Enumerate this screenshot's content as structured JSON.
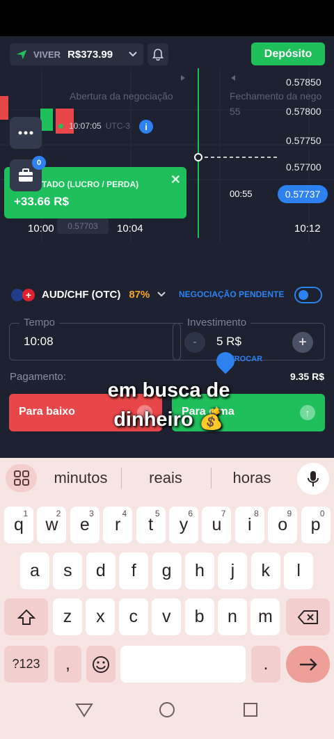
{
  "header": {
    "mode_label": "VIVER",
    "balance": "R$373.99",
    "deposit_label": "Depósito"
  },
  "chart": {
    "price_labels": [
      "0.57850",
      "0.57800",
      "0.57750",
      "0.57700"
    ],
    "current_price": "0.57737",
    "countdown": "00:55",
    "time_labels": [
      "10:00",
      "10:04",
      "10:12"
    ],
    "open_time": "10:07:05",
    "utc_label": "UTC-3",
    "open_label": "Abertura da negociação",
    "close_label": "Fechamento da nego",
    "close_counter": "55",
    "open_price": "0.57703",
    "info_label": "i"
  },
  "result_panel": {
    "label": "TADO (LUCRO / PERDA)",
    "value": "+33.66 R$",
    "badge": "0"
  },
  "pair": {
    "name": "AUD/CHF (OTC)",
    "payout_pct": "87%",
    "pending_label": "NEGOCIAÇÃO PENDENTE"
  },
  "inputs": {
    "time_legend": "Tempo",
    "time_value": "10:08",
    "investment_legend": "Investimento",
    "investment_value": "5 R$",
    "minus": "-",
    "plus": "+",
    "swap_label": "TROCAR"
  },
  "payment": {
    "label": "Pagamento:",
    "value": "9.35 R$"
  },
  "actions": {
    "down_label": "Para baixo",
    "up_label": "Para cima"
  },
  "overlay": {
    "caption": "em busca de dinheiro 💰"
  },
  "keyboard": {
    "suggestions": [
      "minutos",
      "reais",
      "horas"
    ],
    "row1": [
      {
        "k": "q",
        "s": "1"
      },
      {
        "k": "w",
        "s": "2"
      },
      {
        "k": "e",
        "s": "3"
      },
      {
        "k": "r",
        "s": "4"
      },
      {
        "k": "t",
        "s": "5"
      },
      {
        "k": "y",
        "s": "6"
      },
      {
        "k": "u",
        "s": "7"
      },
      {
        "k": "i",
        "s": "8"
      },
      {
        "k": "o",
        "s": "9"
      },
      {
        "k": "p",
        "s": "0"
      }
    ],
    "row2": [
      "a",
      "s",
      "d",
      "f",
      "g",
      "h",
      "j",
      "k",
      "l"
    ],
    "row3": [
      "z",
      "x",
      "c",
      "v",
      "b",
      "n",
      "m"
    ],
    "symbols_label": "?123",
    "comma": ",",
    "period": "."
  },
  "colors": {
    "app_bg": "#1d2130",
    "green": "#1fbf5c",
    "red": "#e8474a",
    "blue": "#2d82f0",
    "orange": "#f5a623",
    "keyboard_bg": "#f7e5e3"
  }
}
